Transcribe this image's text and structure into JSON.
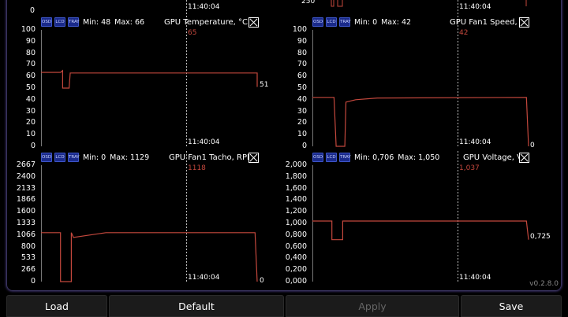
{
  "app": {
    "version": "v0.2.8.0"
  },
  "top_partial": {
    "left_zero": "0",
    "left_time": "11:40:04",
    "right_time": "11:40:04"
  },
  "panels": [
    {
      "badges": [
        "OSD",
        "LCD",
        "TRAY"
      ],
      "min_label": "Min:",
      "min": "48",
      "max_label": "Max:",
      "max": "66",
      "title": "GPU Temperature, °C",
      "current": "65",
      "end_value": "51",
      "time": "11:40:04",
      "y_ticks": [
        "100",
        "90",
        "80",
        "70",
        "60",
        "50",
        "40",
        "30",
        "20",
        "10",
        "0"
      ]
    },
    {
      "badges": [
        "OSD",
        "LCD",
        "TRAY"
      ],
      "min_label": "Min:",
      "min": "0",
      "max_label": "Max:",
      "max": "42",
      "title": "GPU Fan1 Speed, %",
      "current": "42",
      "end_value": "0",
      "time": "11:40:04",
      "y_ticks": [
        "100",
        "90",
        "80",
        "70",
        "60",
        "50",
        "40",
        "30",
        "20",
        "10",
        "0"
      ]
    },
    {
      "badges": [
        "OSD",
        "LCD",
        "TRAY"
      ],
      "min_label": "Min:",
      "min": "0",
      "max_label": "Max:",
      "max": "1129",
      "title": "GPU Fan1 Tacho, RPM",
      "current": "1118",
      "end_value": "0",
      "time": "11:40:04",
      "y_ticks": [
        "2667",
        "2400",
        "2133",
        "1866",
        "1600",
        "1333",
        "1066",
        "800",
        "533",
        "266",
        "0"
      ]
    },
    {
      "badges": [
        "OSD",
        "LCD",
        "TRAY"
      ],
      "min_label": "Min:",
      "min": "0,706",
      "max_label": "Max:",
      "max": "1,050",
      "title": "GPU Voltage, V",
      "current": "1,037",
      "end_value": "0,725",
      "time": "11:40:04",
      "y_ticks": [
        "2,000",
        "1,800",
        "1,600",
        "1,400",
        "1,200",
        "1,000",
        "0,800",
        "0,600",
        "0,400",
        "0,200",
        "0,000"
      ]
    }
  ],
  "buttons": {
    "load": "Load",
    "default": "Default",
    "apply": "Apply",
    "save": "Save"
  },
  "colors": {
    "graph_line": "#c4483d",
    "badge_bg": "#1a2a8a",
    "frame_border": "#3a3460"
  }
}
